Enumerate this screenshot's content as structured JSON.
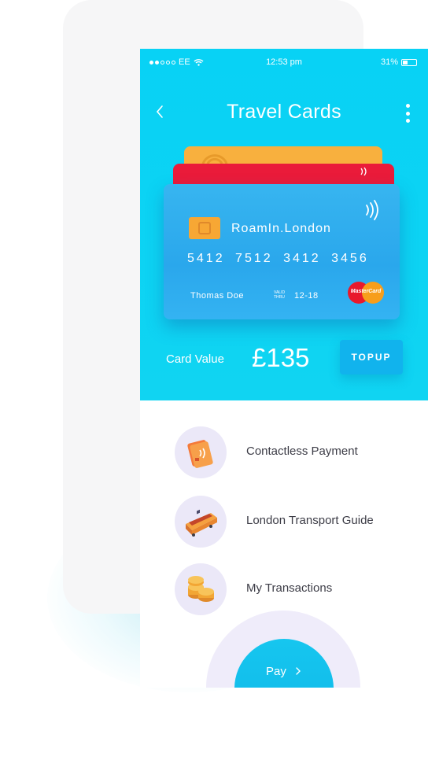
{
  "status_bar": {
    "carrier": "EE",
    "time": "12:53 pm",
    "battery": "31%"
  },
  "header": {
    "title": "Travel Cards"
  },
  "card": {
    "brand": "RoamIn.London",
    "number": "5412 7512 3412 3456",
    "holder": "Thomas Doe",
    "valid_thru_label": "VALID THRU",
    "expiry": "12-18",
    "network": "MasterCard"
  },
  "balance": {
    "label": "Card Value",
    "amount": "£135",
    "topup_label": "TOPUP"
  },
  "menu": {
    "items": [
      {
        "label": "Contactless Payment",
        "icon": "contactless-card-icon"
      },
      {
        "label": "London Transport Guide",
        "icon": "train-icon"
      },
      {
        "label": "My Transactions",
        "icon": "coins-icon"
      }
    ]
  },
  "pay": {
    "label": "Pay"
  },
  "colors": {
    "header": "#0ad3f4",
    "card_blue": "#2aa7ec",
    "card_red": "#ea1b3a",
    "card_orange": "#f8b03e",
    "icon_bg": "#ebe8f8",
    "text_dark": "#3c3c46"
  }
}
